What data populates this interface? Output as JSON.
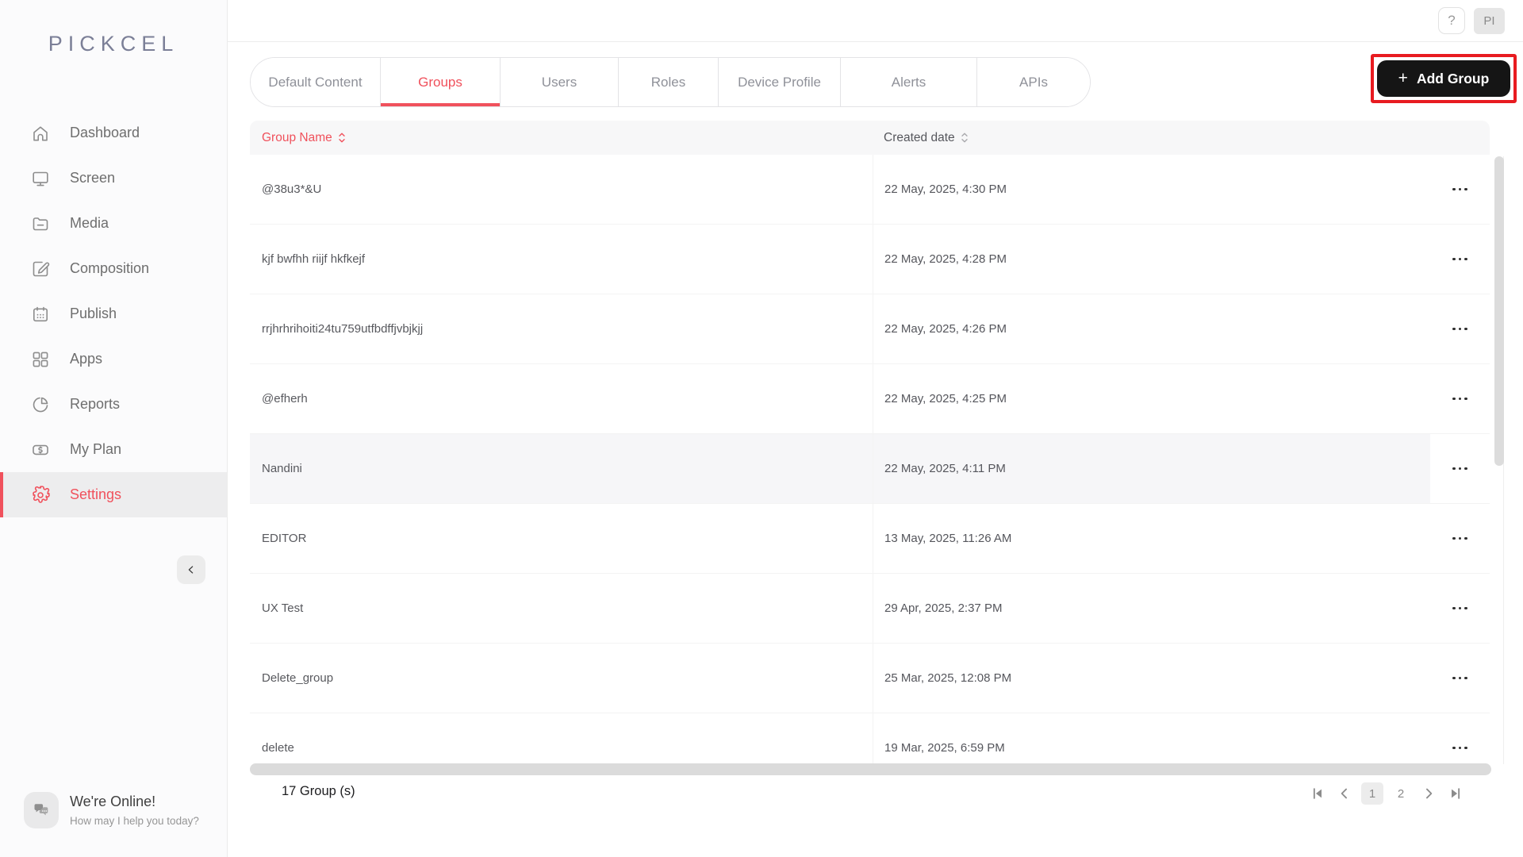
{
  "brand": {
    "logo": "PICKCEL"
  },
  "topbar": {
    "help": "?",
    "avatar": "PI"
  },
  "sidebar": {
    "items": [
      {
        "label": "Dashboard",
        "icon": "home",
        "active": false
      },
      {
        "label": "Screen",
        "icon": "monitor",
        "active": false
      },
      {
        "label": "Media",
        "icon": "folder",
        "active": false
      },
      {
        "label": "Composition",
        "icon": "compose",
        "active": false
      },
      {
        "label": "Publish",
        "icon": "calendar",
        "active": false
      },
      {
        "label": "Apps",
        "icon": "grid",
        "active": false
      },
      {
        "label": "Reports",
        "icon": "pie",
        "active": false
      },
      {
        "label": "My Plan",
        "icon": "money",
        "active": false
      },
      {
        "label": "Settings",
        "icon": "gear",
        "active": true
      }
    ]
  },
  "tabs": [
    {
      "label": "Default Content",
      "active": false
    },
    {
      "label": "Groups",
      "active": true
    },
    {
      "label": "Users",
      "active": false
    },
    {
      "label": "Roles",
      "active": false
    },
    {
      "label": "Device Profile",
      "active": false
    },
    {
      "label": "Alerts",
      "active": false
    },
    {
      "label": "APIs",
      "active": false
    }
  ],
  "add_group": {
    "plus": "+",
    "label": "Add Group"
  },
  "table": {
    "columns": [
      {
        "label": "Group Name"
      },
      {
        "label": "Created date"
      }
    ],
    "rows": [
      {
        "name": "@38u3*&U",
        "created": "22 May, 2025, 4:30 PM",
        "highlighted": false
      },
      {
        "name": "kjf bwfhh riijf hkfkejf",
        "created": "22 May, 2025, 4:28 PM",
        "highlighted": false
      },
      {
        "name": "rrjhrhrihoiti24tu759utfbdffjvbjkjj",
        "created": "22 May, 2025, 4:26 PM",
        "highlighted": false
      },
      {
        "name": "@efherh",
        "created": "22 May, 2025, 4:25 PM",
        "highlighted": false
      },
      {
        "name": "Nandini",
        "created": "22 May, 2025, 4:11 PM",
        "highlighted": true
      },
      {
        "name": "EDITOR",
        "created": "13 May, 2025, 11:26 AM",
        "highlighted": false
      },
      {
        "name": "UX Test",
        "created": "29 Apr, 2025, 2:37 PM",
        "highlighted": false
      },
      {
        "name": "Delete_group",
        "created": "25 Mar, 2025, 12:08 PM",
        "highlighted": false
      },
      {
        "name": "delete",
        "created": "19 Mar, 2025, 6:59 PM",
        "highlighted": false
      }
    ]
  },
  "footer": {
    "count": "17 Group (s)",
    "pages": [
      "1",
      "2"
    ],
    "current_page": "1"
  },
  "chat": {
    "title": "We're Online!",
    "subtitle": "How may I help you today?"
  },
  "colors": {
    "accent": "#f0515c",
    "annotation": "#e81b20",
    "button_bg": "#151515",
    "logo": "#7b7f97"
  }
}
